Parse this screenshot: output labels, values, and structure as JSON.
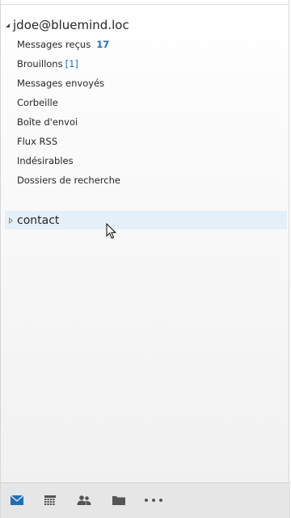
{
  "account": {
    "email": "jdoe@bluemind.loc"
  },
  "folders": [
    {
      "label": "Messages reçus",
      "count": "17"
    },
    {
      "label": "Brouillons",
      "count": "[1]"
    },
    {
      "label": "Messages envoyés"
    },
    {
      "label": "Corbeille"
    },
    {
      "label": "Boîte d'envoi"
    },
    {
      "label": "Flux RSS"
    },
    {
      "label": "Indésirables"
    },
    {
      "label": "Dossiers de recherche"
    }
  ],
  "contact_group": {
    "label": "contact"
  },
  "bottom_nav": {
    "items": [
      "mail-icon",
      "calendar-icon",
      "people-icon",
      "tasks-icon",
      "more-icon"
    ],
    "active_color": "#1f6fb6"
  }
}
